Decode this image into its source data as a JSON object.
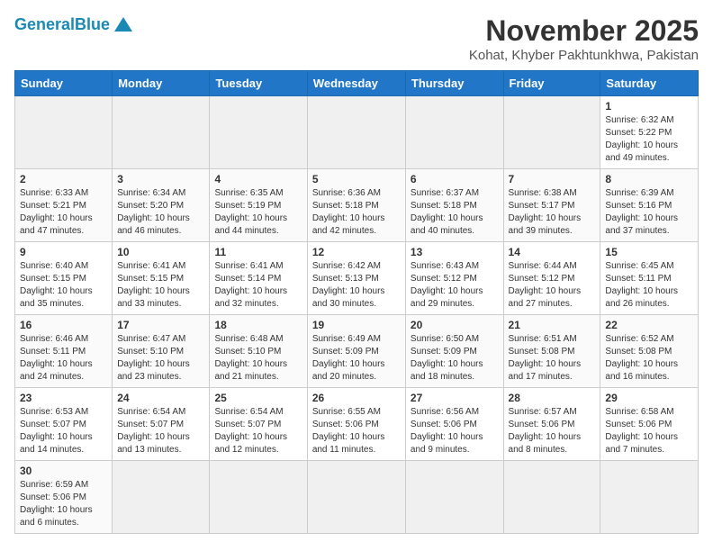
{
  "header": {
    "logo_general": "General",
    "logo_blue": "Blue",
    "month": "November 2025",
    "location": "Kohat, Khyber Pakhtunkhwa, Pakistan"
  },
  "weekdays": [
    "Sunday",
    "Monday",
    "Tuesday",
    "Wednesday",
    "Thursday",
    "Friday",
    "Saturday"
  ],
  "weeks": [
    [
      {
        "day": "",
        "info": ""
      },
      {
        "day": "",
        "info": ""
      },
      {
        "day": "",
        "info": ""
      },
      {
        "day": "",
        "info": ""
      },
      {
        "day": "",
        "info": ""
      },
      {
        "day": "",
        "info": ""
      },
      {
        "day": "1",
        "info": "Sunrise: 6:32 AM\nSunset: 5:22 PM\nDaylight: 10 hours and 49 minutes."
      }
    ],
    [
      {
        "day": "2",
        "info": "Sunrise: 6:33 AM\nSunset: 5:21 PM\nDaylight: 10 hours and 47 minutes."
      },
      {
        "day": "3",
        "info": "Sunrise: 6:34 AM\nSunset: 5:20 PM\nDaylight: 10 hours and 46 minutes."
      },
      {
        "day": "4",
        "info": "Sunrise: 6:35 AM\nSunset: 5:19 PM\nDaylight: 10 hours and 44 minutes."
      },
      {
        "day": "5",
        "info": "Sunrise: 6:36 AM\nSunset: 5:18 PM\nDaylight: 10 hours and 42 minutes."
      },
      {
        "day": "6",
        "info": "Sunrise: 6:37 AM\nSunset: 5:18 PM\nDaylight: 10 hours and 40 minutes."
      },
      {
        "day": "7",
        "info": "Sunrise: 6:38 AM\nSunset: 5:17 PM\nDaylight: 10 hours and 39 minutes."
      },
      {
        "day": "8",
        "info": "Sunrise: 6:39 AM\nSunset: 5:16 PM\nDaylight: 10 hours and 37 minutes."
      }
    ],
    [
      {
        "day": "9",
        "info": "Sunrise: 6:40 AM\nSunset: 5:15 PM\nDaylight: 10 hours and 35 minutes."
      },
      {
        "day": "10",
        "info": "Sunrise: 6:41 AM\nSunset: 5:15 PM\nDaylight: 10 hours and 33 minutes."
      },
      {
        "day": "11",
        "info": "Sunrise: 6:41 AM\nSunset: 5:14 PM\nDaylight: 10 hours and 32 minutes."
      },
      {
        "day": "12",
        "info": "Sunrise: 6:42 AM\nSunset: 5:13 PM\nDaylight: 10 hours and 30 minutes."
      },
      {
        "day": "13",
        "info": "Sunrise: 6:43 AM\nSunset: 5:12 PM\nDaylight: 10 hours and 29 minutes."
      },
      {
        "day": "14",
        "info": "Sunrise: 6:44 AM\nSunset: 5:12 PM\nDaylight: 10 hours and 27 minutes."
      },
      {
        "day": "15",
        "info": "Sunrise: 6:45 AM\nSunset: 5:11 PM\nDaylight: 10 hours and 26 minutes."
      }
    ],
    [
      {
        "day": "16",
        "info": "Sunrise: 6:46 AM\nSunset: 5:11 PM\nDaylight: 10 hours and 24 minutes."
      },
      {
        "day": "17",
        "info": "Sunrise: 6:47 AM\nSunset: 5:10 PM\nDaylight: 10 hours and 23 minutes."
      },
      {
        "day": "18",
        "info": "Sunrise: 6:48 AM\nSunset: 5:10 PM\nDaylight: 10 hours and 21 minutes."
      },
      {
        "day": "19",
        "info": "Sunrise: 6:49 AM\nSunset: 5:09 PM\nDaylight: 10 hours and 20 minutes."
      },
      {
        "day": "20",
        "info": "Sunrise: 6:50 AM\nSunset: 5:09 PM\nDaylight: 10 hours and 18 minutes."
      },
      {
        "day": "21",
        "info": "Sunrise: 6:51 AM\nSunset: 5:08 PM\nDaylight: 10 hours and 17 minutes."
      },
      {
        "day": "22",
        "info": "Sunrise: 6:52 AM\nSunset: 5:08 PM\nDaylight: 10 hours and 16 minutes."
      }
    ],
    [
      {
        "day": "23",
        "info": "Sunrise: 6:53 AM\nSunset: 5:07 PM\nDaylight: 10 hours and 14 minutes."
      },
      {
        "day": "24",
        "info": "Sunrise: 6:54 AM\nSunset: 5:07 PM\nDaylight: 10 hours and 13 minutes."
      },
      {
        "day": "25",
        "info": "Sunrise: 6:54 AM\nSunset: 5:07 PM\nDaylight: 10 hours and 12 minutes."
      },
      {
        "day": "26",
        "info": "Sunrise: 6:55 AM\nSunset: 5:06 PM\nDaylight: 10 hours and 11 minutes."
      },
      {
        "day": "27",
        "info": "Sunrise: 6:56 AM\nSunset: 5:06 PM\nDaylight: 10 hours and 9 minutes."
      },
      {
        "day": "28",
        "info": "Sunrise: 6:57 AM\nSunset: 5:06 PM\nDaylight: 10 hours and 8 minutes."
      },
      {
        "day": "29",
        "info": "Sunrise: 6:58 AM\nSunset: 5:06 PM\nDaylight: 10 hours and 7 minutes."
      }
    ],
    [
      {
        "day": "30",
        "info": "Sunrise: 6:59 AM\nSunset: 5:06 PM\nDaylight: 10 hours and 6 minutes."
      },
      {
        "day": "",
        "info": ""
      },
      {
        "day": "",
        "info": ""
      },
      {
        "day": "",
        "info": ""
      },
      {
        "day": "",
        "info": ""
      },
      {
        "day": "",
        "info": ""
      },
      {
        "day": "",
        "info": ""
      }
    ]
  ]
}
